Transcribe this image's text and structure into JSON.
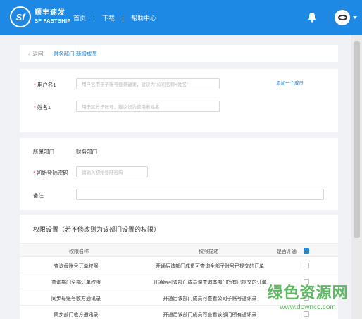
{
  "header": {
    "logo_mark": "Sf",
    "logo_cn": "顺丰速发",
    "logo_en": "SF FASTSHIP",
    "nav": [
      "首页",
      "下载",
      "帮助中心"
    ]
  },
  "breadcrumb": {
    "back": "返回",
    "path": "财务部门-新增成员"
  },
  "form": {
    "username_label": "用户名1",
    "username_placeholder": "用户名用于子账号登录速发，建议为\"公司名称+姓名\"",
    "add_member": "添加一个成员",
    "name_label": "姓名1",
    "name_placeholder": "用于区分子账号，建议设为使用者姓名",
    "dept_label": "所属部门",
    "dept_value": "财务部门",
    "password_label": "初始登陆密码",
    "password_placeholder": "请输入初始登陆密码",
    "note_label": "备注",
    "note_value": ""
  },
  "permissions": {
    "title": "权限设置（若不修改则为该部门设置的权限）",
    "columns": [
      "权限名称",
      "权限描述",
      "是否开通"
    ],
    "rows": [
      {
        "name": "查询母账号订单权限",
        "desc": "开通后该部门成员可查询全部子账号已提交的订单"
      },
      {
        "name": "查询部门全部订单权限",
        "desc": "开通后可该部门成员课查询本部门所有已提交的订单"
      },
      {
        "name": "同步母账号收方通讯录",
        "desc": "开通后该部门成员可查看公司子账号通讯录"
      },
      {
        "name": "同步部门收方通讯录",
        "desc": "开通后该部门成员可查看该部门所有通讯录"
      }
    ]
  },
  "watermark": {
    "cn": "绿色资源网",
    "url": "www.downcc.com"
  },
  "colors": {
    "primary": "#1e88e5",
    "required": "#e53935"
  }
}
